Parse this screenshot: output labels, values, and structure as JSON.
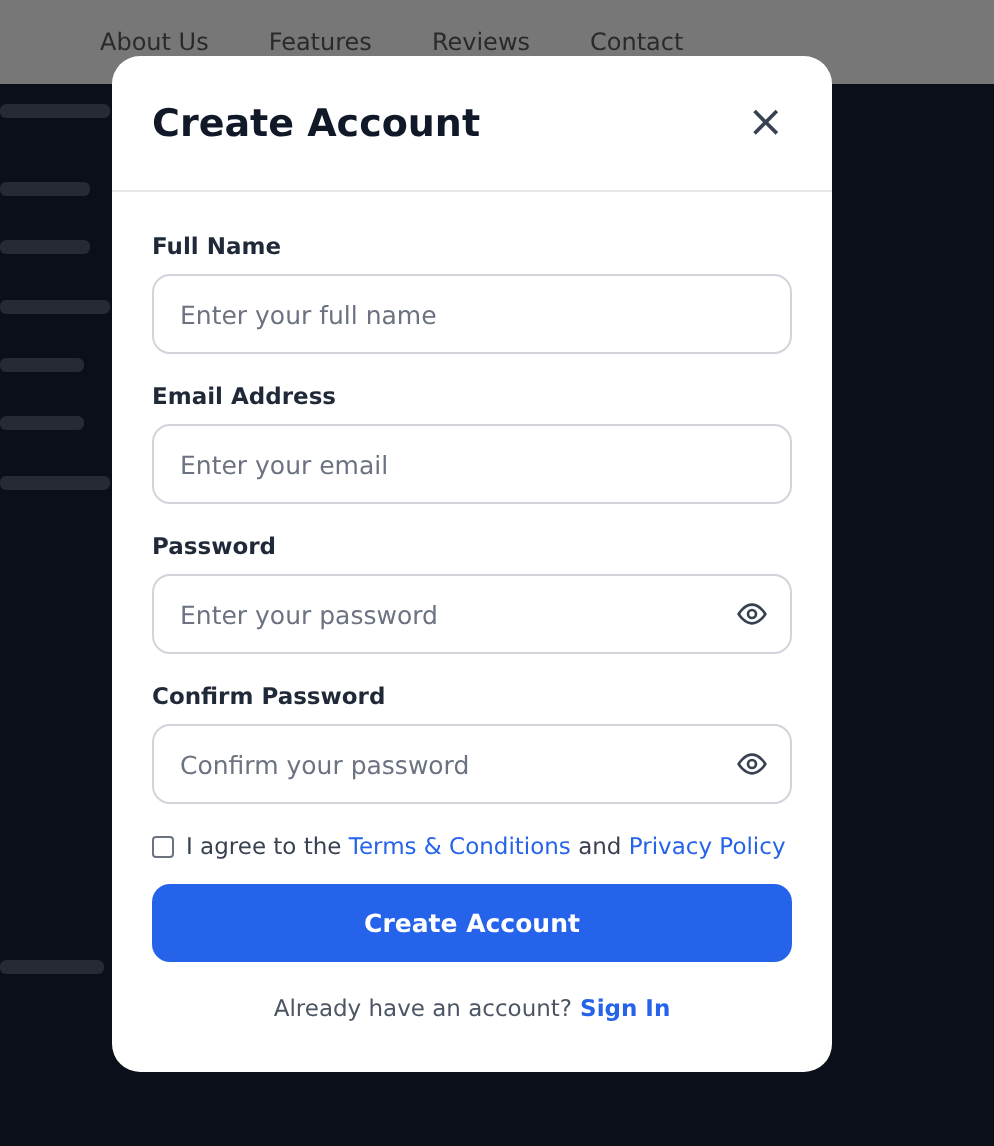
{
  "background": {
    "nav": [
      "About Us",
      "Features",
      "Reviews",
      "Contact"
    ]
  },
  "modal": {
    "title": "Create Account",
    "close": "×",
    "fields": [
      {
        "label": "Full Name",
        "placeholder": "Enter your full name",
        "kind": "text"
      },
      {
        "label": "Email Address",
        "placeholder": "Enter your email",
        "kind": "text"
      },
      {
        "label": "Password",
        "placeholder": "Enter your password",
        "kind": "password"
      },
      {
        "label": "Confirm Password",
        "placeholder": "Confirm your password",
        "kind": "password"
      }
    ],
    "agree": {
      "checked": false,
      "prefix": "I agree to the",
      "terms": "Terms & Conditions",
      "and": "and",
      "privacy": "Privacy Policy"
    },
    "submit": "Create Account",
    "footer": {
      "text": "Already have an account?",
      "link": "Sign In"
    }
  }
}
